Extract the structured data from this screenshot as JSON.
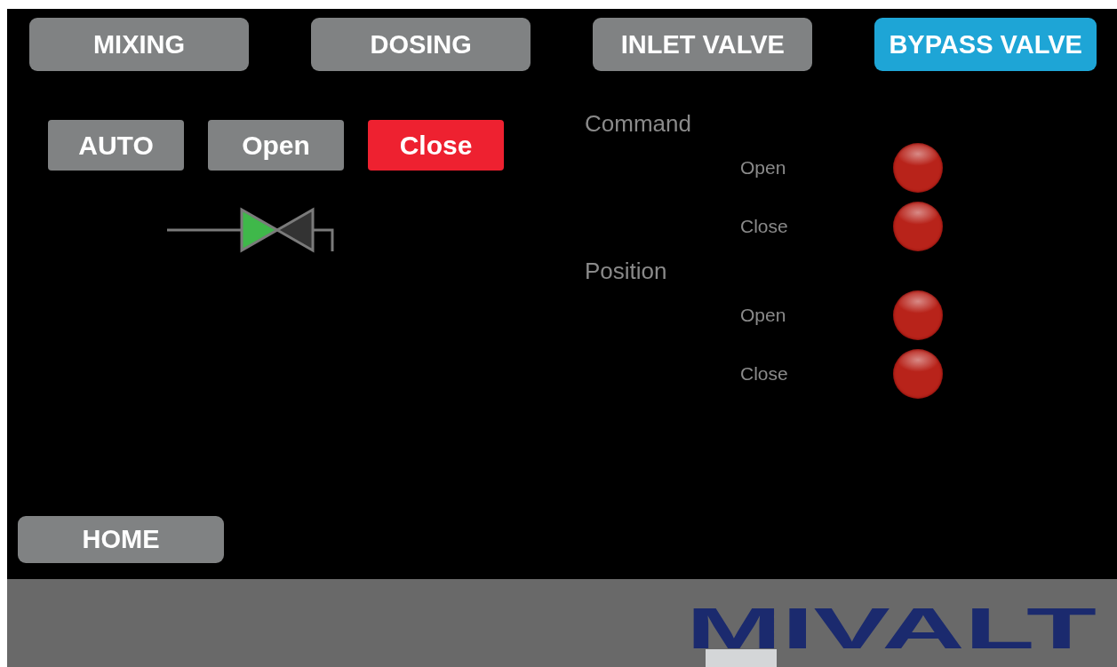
{
  "tabs": [
    {
      "label": "MIXING",
      "selected": false
    },
    {
      "label": "DOSING",
      "selected": false
    },
    {
      "label": "INLET VALVE",
      "selected": false
    },
    {
      "label": "BYPASS VALVE",
      "selected": true
    }
  ],
  "modes": [
    {
      "label": "AUTO",
      "selected": false
    },
    {
      "label": "Open",
      "selected": false
    },
    {
      "label": "Close",
      "selected": true
    }
  ],
  "valve": {
    "open": true
  },
  "groups": [
    {
      "title": "Command",
      "signals": [
        {
          "label": "Open",
          "on": false
        },
        {
          "label": "Close",
          "on": false
        }
      ]
    },
    {
      "title": "Position",
      "signals": [
        {
          "label": "Open",
          "on": false
        },
        {
          "label": "Close",
          "on": false
        }
      ]
    }
  ],
  "home_button": "HOME",
  "logo": "MIVALT"
}
